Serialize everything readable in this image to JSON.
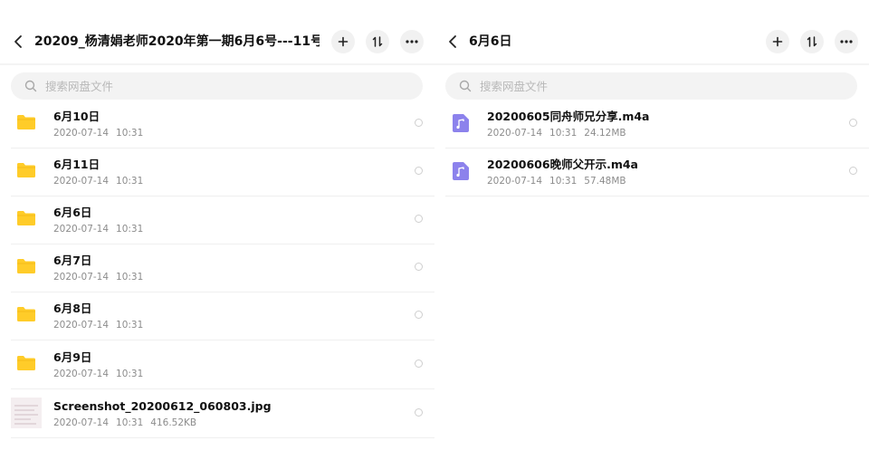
{
  "colors": {
    "folder": "#FFCC29",
    "audio": "#8C82EC",
    "accent_text": "#111111",
    "meta_text": "#8C8C8C",
    "button_bg": "#F1F1F1",
    "search_bg": "#F3F3F3"
  },
  "left": {
    "header": {
      "back_icon": "chevron-left-icon",
      "title": "20209_杨清娟老师2020年第一期6月6号---11号..."
    },
    "actions": [
      "plus-icon",
      "sort-icon",
      "more-icon"
    ],
    "search": {
      "placeholder": "搜索网盘文件",
      "value": ""
    },
    "items": [
      {
        "kind": "folder",
        "name": "6月10日",
        "date": "2020-07-14",
        "time": "10:31",
        "size": ""
      },
      {
        "kind": "folder",
        "name": "6月11日",
        "date": "2020-07-14",
        "time": "10:31",
        "size": ""
      },
      {
        "kind": "folder",
        "name": "6月6日",
        "date": "2020-07-14",
        "time": "10:31",
        "size": ""
      },
      {
        "kind": "folder",
        "name": "6月7日",
        "date": "2020-07-14",
        "time": "10:31",
        "size": ""
      },
      {
        "kind": "folder",
        "name": "6月8日",
        "date": "2020-07-14",
        "time": "10:31",
        "size": ""
      },
      {
        "kind": "folder",
        "name": "6月9日",
        "date": "2020-07-14",
        "time": "10:31",
        "size": ""
      },
      {
        "kind": "image",
        "name": "Screenshot_20200612_060803.jpg",
        "date": "2020-07-14",
        "time": "10:31",
        "size": "416.52KB"
      }
    ]
  },
  "right": {
    "header": {
      "back_icon": "chevron-left-icon",
      "title": "6月6日"
    },
    "actions": [
      "plus-icon",
      "sort-icon",
      "more-icon"
    ],
    "search": {
      "placeholder": "搜索网盘文件",
      "value": ""
    },
    "items": [
      {
        "kind": "audio",
        "name": "20200605同舟师兄分享.m4a",
        "date": "2020-07-14",
        "time": "10:31",
        "size": "24.12MB"
      },
      {
        "kind": "audio",
        "name": "20200606晚师父开示.m4a",
        "date": "2020-07-14",
        "time": "10:31",
        "size": "57.48MB"
      }
    ]
  }
}
